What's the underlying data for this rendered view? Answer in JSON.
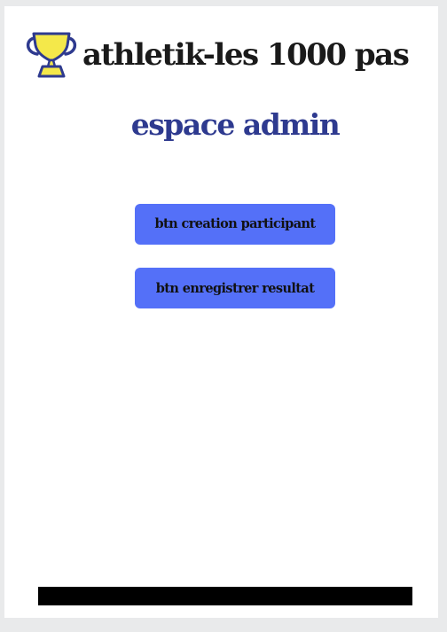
{
  "header": {
    "icon": "trophy-icon",
    "title": "athletik-les 1000 pas"
  },
  "main": {
    "subtitle": "espace admin",
    "buttons": [
      {
        "label": "btn creation participant"
      },
      {
        "label": "btn enregistrer resultat"
      }
    ]
  },
  "colors": {
    "background": "#e9eaeb",
    "page": "#ffffff",
    "title_text": "#1a1a1a",
    "subtitle_text": "#2e3a8f",
    "button_bg": "#5470f8",
    "trophy_fill": "#f4e84a",
    "trophy_stroke": "#2e3a8f",
    "footer_bar": "#000000"
  }
}
